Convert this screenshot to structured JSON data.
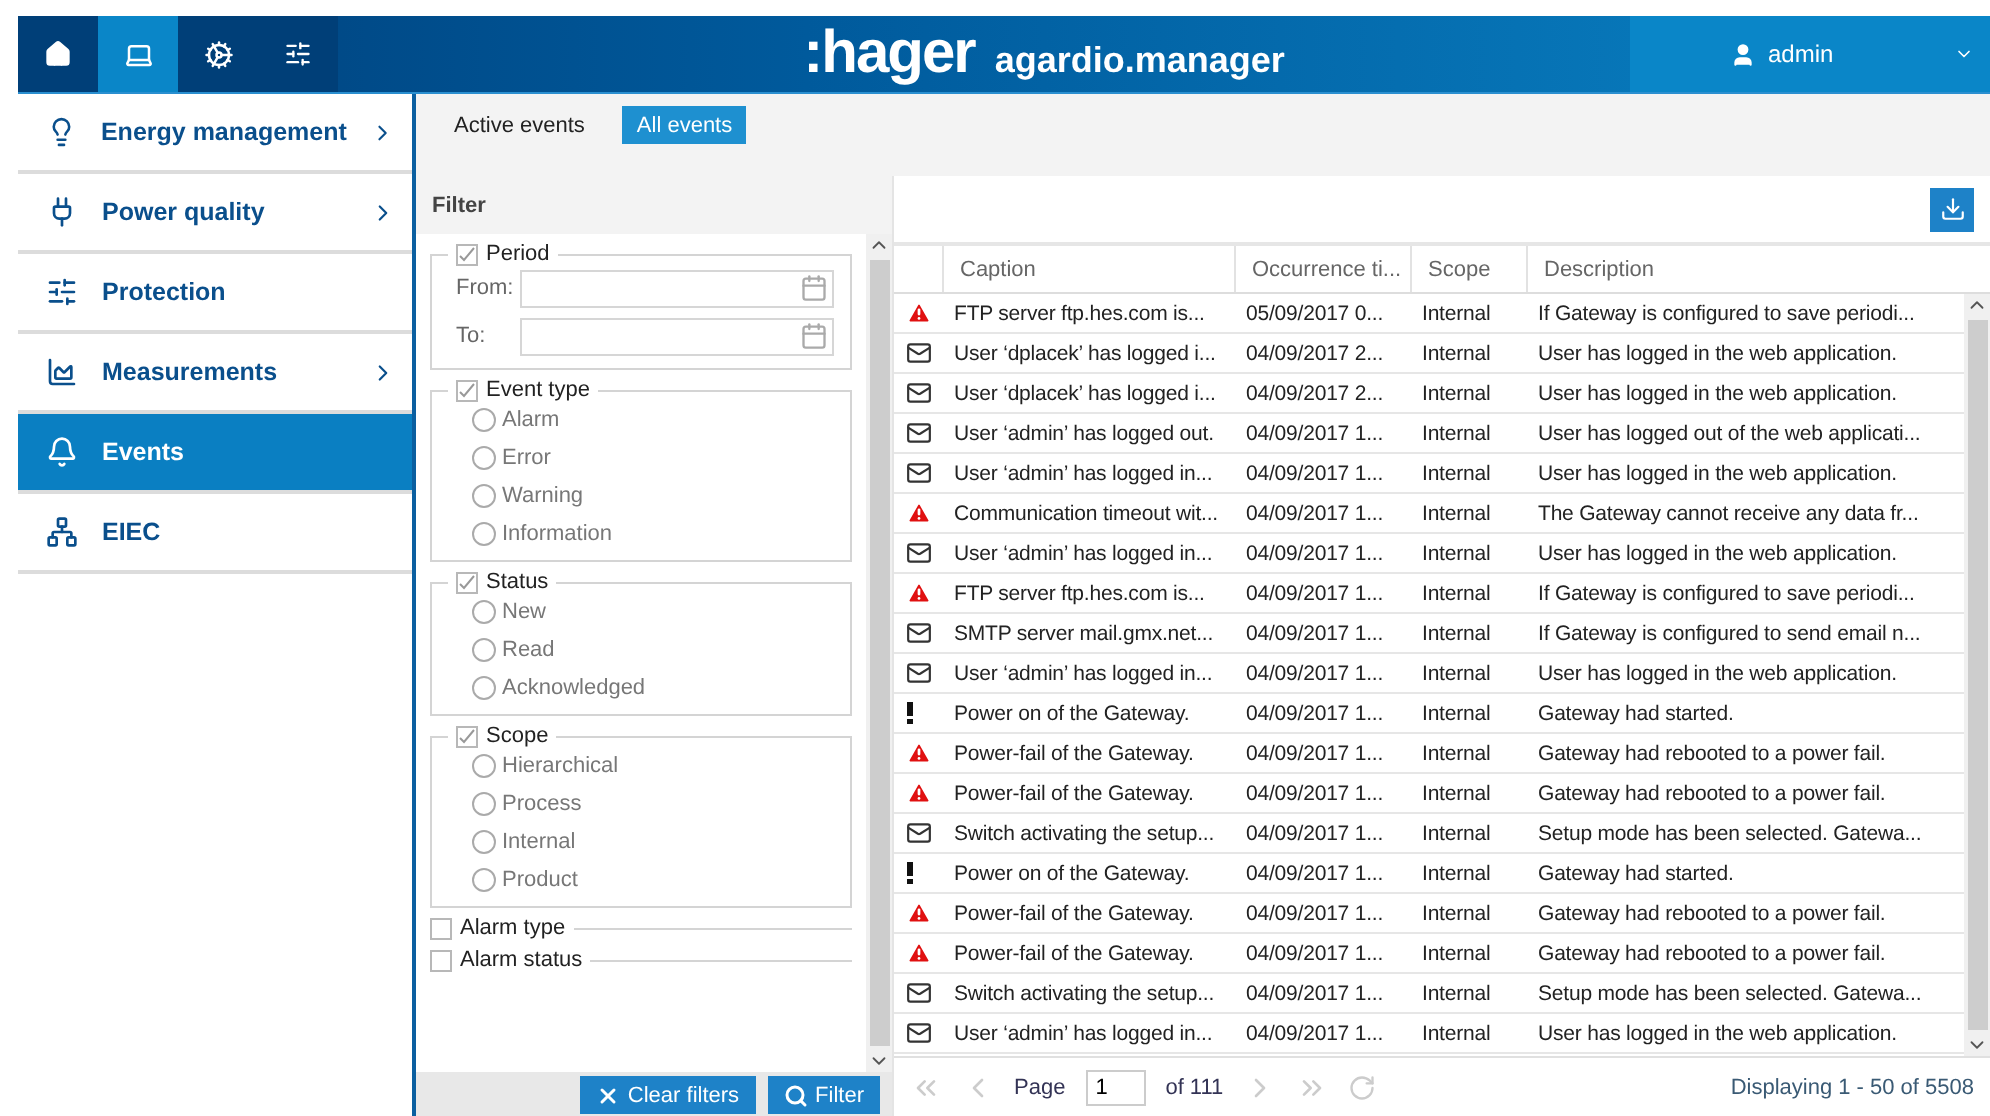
{
  "header": {
    "nav_icons": [
      {
        "kind": "home",
        "selected": false
      },
      {
        "kind": "laptop",
        "selected": true
      },
      {
        "kind": "gears",
        "selected": false
      },
      {
        "kind": "sliders",
        "selected": false
      }
    ],
    "logo": ":hager",
    "product": "agardio.manager",
    "user": "admin"
  },
  "sidebar": {
    "items": [
      {
        "label": "Energy management",
        "has_submenu": true,
        "selected": false
      },
      {
        "label": "Power quality",
        "has_submenu": true,
        "selected": false
      },
      {
        "label": "Protection",
        "has_submenu": false,
        "selected": false
      },
      {
        "label": "Measurements",
        "has_submenu": true,
        "selected": false
      },
      {
        "label": "Events",
        "has_submenu": false,
        "selected": true
      },
      {
        "label": "EIEC",
        "has_submenu": false,
        "selected": false
      }
    ]
  },
  "tabs": [
    {
      "label": "Active events",
      "selected": false
    },
    {
      "label": "All events",
      "selected": true
    }
  ],
  "filter": {
    "title": "Filter",
    "groups": [
      {
        "label": "Period",
        "checked": true,
        "kind": "dates",
        "fields": [
          {
            "label": "From:"
          },
          {
            "label": "To:"
          }
        ]
      },
      {
        "label": "Event type",
        "checked": true,
        "kind": "options",
        "options": [
          {
            "label": "Alarm",
            "selected": false
          },
          {
            "label": "Error",
            "selected": false
          },
          {
            "label": "Warning",
            "selected": false
          },
          {
            "label": "Information",
            "selected": false
          }
        ]
      },
      {
        "label": "Status",
        "checked": true,
        "kind": "options",
        "options": [
          {
            "label": "New",
            "selected": false
          },
          {
            "label": "Read",
            "selected": false
          },
          {
            "label": "Acknowledged",
            "selected": false
          }
        ]
      },
      {
        "label": "Scope",
        "checked": true,
        "kind": "options",
        "options": [
          {
            "label": "Hierarchical",
            "selected": false
          },
          {
            "label": "Process",
            "selected": false
          },
          {
            "label": "Internal",
            "selected": false
          },
          {
            "label": "Product",
            "selected": false
          }
        ]
      },
      {
        "label": "Alarm type",
        "checked": false,
        "kind": "collapsed"
      },
      {
        "label": "Alarm status",
        "checked": false,
        "kind": "collapsed"
      }
    ],
    "buttons": [
      {
        "label": "Clear filters",
        "kind": "clear"
      },
      {
        "label": "Filter",
        "kind": "search"
      }
    ]
  },
  "table": {
    "columns": [
      "Caption",
      "Occurrence ti...",
      "Scope",
      "Description"
    ],
    "rows": [
      {
        "kind": "alarm",
        "caption": "FTP server ftp.hes.com is...",
        "time": "05/09/2017 0...",
        "scope": "Internal",
        "description": "If Gateway is configured to save periodi..."
      },
      {
        "kind": "message",
        "caption": "User ‘dplacek’ has logged i...",
        "time": "04/09/2017 2...",
        "scope": "Internal",
        "description": "User has logged in the web application."
      },
      {
        "kind": "message",
        "caption": "User ‘dplacek’ has logged i...",
        "time": "04/09/2017 2...",
        "scope": "Internal",
        "description": "User has logged in the web application."
      },
      {
        "kind": "message",
        "caption": "User ‘admin’ has logged out.",
        "time": "04/09/2017 1...",
        "scope": "Internal",
        "description": "User has logged out of the web applicati..."
      },
      {
        "kind": "message",
        "caption": "User ‘admin’ has logged in...",
        "time": "04/09/2017 1...",
        "scope": "Internal",
        "description": "User has logged in the web application."
      },
      {
        "kind": "alarm",
        "caption": "Communication timeout wit...",
        "time": "04/09/2017 1...",
        "scope": "Internal",
        "description": "The Gateway cannot receive any data fr..."
      },
      {
        "kind": "message",
        "caption": "User ‘admin’ has logged in...",
        "time": "04/09/2017 1...",
        "scope": "Internal",
        "description": "User has logged in the web application."
      },
      {
        "kind": "alarm",
        "caption": "FTP server ftp.hes.com is...",
        "time": "04/09/2017 1...",
        "scope": "Internal",
        "description": "If Gateway is configured to save periodi..."
      },
      {
        "kind": "message",
        "caption": "SMTP server mail.gmx.net...",
        "time": "04/09/2017 1...",
        "scope": "Internal",
        "description": "If Gateway is configured to send email n..."
      },
      {
        "kind": "message",
        "caption": "User ‘admin’ has logged in...",
        "time": "04/09/2017 1...",
        "scope": "Internal",
        "description": "User has logged in the web application."
      },
      {
        "kind": "info",
        "caption": "Power on of the Gateway.",
        "time": "04/09/2017 1...",
        "scope": "Internal",
        "description": "Gateway had started."
      },
      {
        "kind": "alarm",
        "caption": "Power-fail of the Gateway.",
        "time": "04/09/2017 1...",
        "scope": "Internal",
        "description": "Gateway had rebooted to a power fail."
      },
      {
        "kind": "alarm",
        "caption": "Power-fail of the Gateway.",
        "time": "04/09/2017 1...",
        "scope": "Internal",
        "description": "Gateway had rebooted to a power fail."
      },
      {
        "kind": "message",
        "caption": "Switch activating the setup...",
        "time": "04/09/2017 1...",
        "scope": "Internal",
        "description": "Setup mode has been selected. Gatewa..."
      },
      {
        "kind": "info",
        "caption": "Power on of the Gateway.",
        "time": "04/09/2017 1...",
        "scope": "Internal",
        "description": "Gateway had started."
      },
      {
        "kind": "alarm",
        "caption": "Power-fail of the Gateway.",
        "time": "04/09/2017 1...",
        "scope": "Internal",
        "description": "Gateway had rebooted to a power fail."
      },
      {
        "kind": "alarm",
        "caption": "Power-fail of the Gateway.",
        "time": "04/09/2017 1...",
        "scope": "Internal",
        "description": "Gateway had rebooted to a power fail."
      },
      {
        "kind": "message",
        "caption": "Switch activating the setup...",
        "time": "04/09/2017 1...",
        "scope": "Internal",
        "description": "Setup mode has been selected. Gatewa..."
      },
      {
        "kind": "message",
        "caption": "User ‘admin’ has logged in...",
        "time": "04/09/2017 1...",
        "scope": "Internal",
        "description": "User has logged in the web application."
      }
    ]
  },
  "pager": {
    "page_label": "Page",
    "page": "1",
    "of": "of 111",
    "display": "Displaying 1 - 50 of 5508"
  }
}
